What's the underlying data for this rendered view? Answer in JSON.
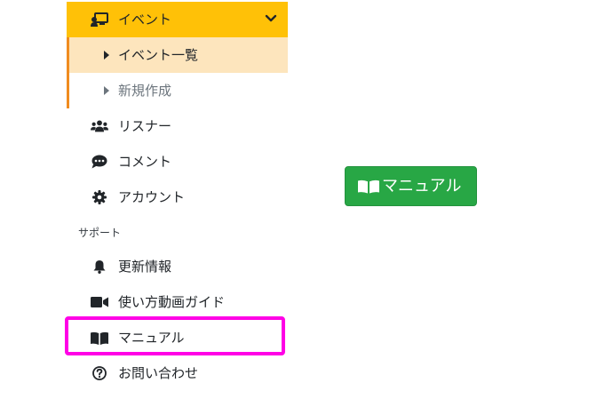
{
  "sidebar": {
    "events": {
      "label": "イベント",
      "icon": "presentation-icon"
    },
    "events_list": {
      "label": "イベント一覧",
      "icon": "caret-right-icon"
    },
    "new_event": {
      "label": "新規作成",
      "icon": "caret-right-icon"
    },
    "listeners": {
      "label": "リスナー",
      "icon": "users-icon"
    },
    "comments": {
      "label": "コメント",
      "icon": "comment-dots-icon"
    },
    "account": {
      "label": "アカウント",
      "icon": "gear-icon"
    },
    "support_section": "サポート",
    "updates": {
      "label": "更新情報",
      "icon": "bell-icon"
    },
    "videos": {
      "label": "使い方動画ガイド",
      "icon": "video-camera-icon"
    },
    "manual": {
      "label": "マニュアル",
      "icon": "book-open-icon"
    },
    "faq": {
      "label": "お問い合わせ",
      "icon": "question-circle-icon"
    }
  },
  "main": {
    "manual_button": {
      "label": "マニュアル",
      "icon": "book-open-icon"
    }
  },
  "colors": {
    "events_bg": "#ffc107",
    "active_sub_bg": "#fde5bd",
    "accent_border": "#f08c1f",
    "highlight": "#ff00e6",
    "button_green": "#28a745"
  }
}
